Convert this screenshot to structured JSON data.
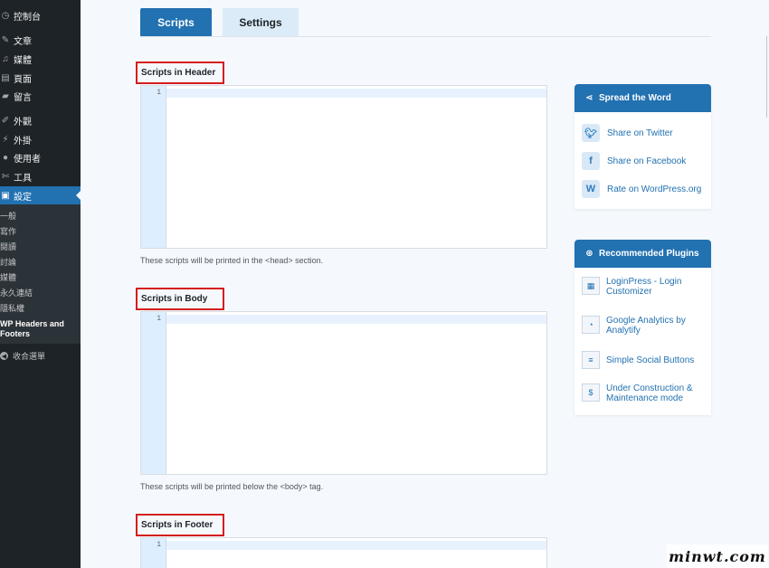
{
  "sidebar": {
    "items": [
      {
        "label": "控制台",
        "icon": "dashboard-icon"
      },
      {
        "label": "文章",
        "icon": "pin-icon"
      },
      {
        "label": "媒體",
        "icon": "media-icon"
      },
      {
        "label": "頁面",
        "icon": "page-icon"
      },
      {
        "label": "留言",
        "icon": "comment-icon"
      },
      {
        "label": "外觀",
        "icon": "brush-icon"
      },
      {
        "label": "外掛",
        "icon": "plugin-icon"
      },
      {
        "label": "使用者",
        "icon": "user-icon"
      },
      {
        "label": "工具",
        "icon": "wrench-icon"
      },
      {
        "label": "設定",
        "icon": "settings-icon"
      }
    ],
    "submenu": [
      "一般",
      "寫作",
      "閱讀",
      "討論",
      "媒體",
      "永久連結",
      "隱私權",
      "WP Headers and Footers"
    ],
    "collapse_label": "收合選單"
  },
  "tabs": {
    "scripts": "Scripts",
    "settings": "Settings"
  },
  "sections": {
    "header": {
      "title": "Scripts in Header",
      "line": "1",
      "description": "These scripts will be printed in the <head> section."
    },
    "body": {
      "title": "Scripts in Body",
      "line": "1",
      "description": "These scripts will be printed below the <body> tag."
    },
    "footer": {
      "title": "Scripts in Footer",
      "line": "1"
    }
  },
  "spread": {
    "title": "Spread the Word",
    "links": [
      {
        "label": "Share on Twitter",
        "icon": "twitter-icon"
      },
      {
        "label": "Share on Facebook",
        "icon": "facebook-icon"
      },
      {
        "label": "Rate on WordPress.org",
        "icon": "wordpress-icon"
      }
    ]
  },
  "recommended": {
    "title": "Recommended Plugins",
    "plugins": [
      {
        "line1": "LoginPress - Login",
        "line2": "Customizer"
      },
      {
        "line1": "Google Analytics by",
        "line2": "Analytify"
      },
      {
        "line1": "Simple Social Buttons",
        "line2": ""
      },
      {
        "line1": "Under Construction &",
        "line2": "Maintenance mode"
      }
    ]
  },
  "watermark": "minwt.com",
  "colors": {
    "accent": "#2271b1",
    "sidebar": "#1d2327",
    "highlight_border": "#d41e1e"
  }
}
